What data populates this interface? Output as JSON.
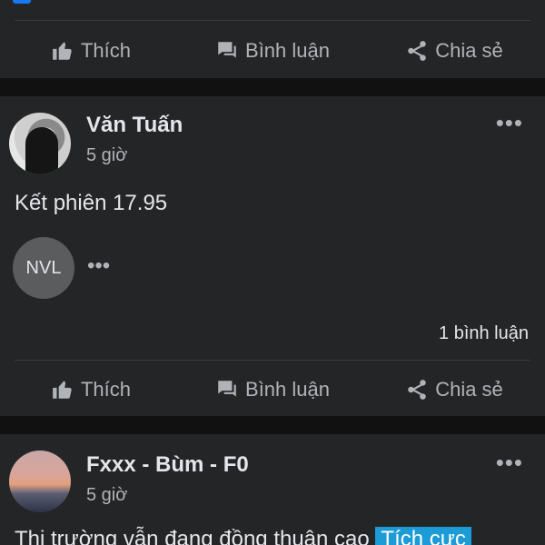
{
  "actions": {
    "like_label": "Thích",
    "comment_label": "Bình luận",
    "share_label": "Chia sẻ"
  },
  "posts": [
    {
      "author": "Văn Tuấn",
      "time": "5 giờ",
      "text": "Kết phiên 17.95",
      "reactor_initials": "NVL",
      "more_reactors": "•••",
      "comment_count": "1 bình luận",
      "more_menu": "•••"
    },
    {
      "author": "Fxxx - Bùm - F0",
      "time": "5 giờ",
      "text": "Thị trường vẫn đang đồng thuận cao",
      "tag": "Tích cực",
      "more_menu": "•••"
    }
  ],
  "colors": {
    "background": "#111111",
    "card": "#242526",
    "text_primary": "#e4e6eb",
    "text_secondary": "#b0b3b8",
    "tag": "#1c9bd6"
  },
  "icons": [
    "like-icon",
    "comment-icon",
    "share-icon"
  ]
}
